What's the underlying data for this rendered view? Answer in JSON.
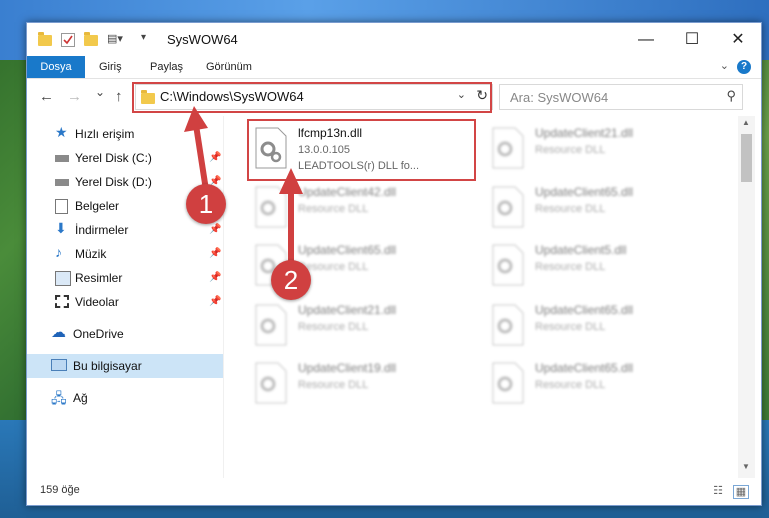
{
  "window": {
    "title": "SysWOW64",
    "controls": {
      "minimize": "—",
      "maximize": "☐",
      "close": "✕"
    }
  },
  "ribbon": {
    "tabs": [
      "Dosya",
      "Giriş",
      "Paylaş",
      "Görünüm"
    ],
    "expand_icon": "chevron-down-icon",
    "help_label": "?"
  },
  "nav": {
    "back": "←",
    "forward": "→",
    "recent": "⌄",
    "up": "↑",
    "address": "C:\\Windows\\SysWOW64",
    "search_placeholder": "Ara: SysWOW64"
  },
  "sidebar": {
    "items": [
      {
        "label": "Hızlı erişim",
        "icon": "star-icon",
        "pinned": false
      },
      {
        "label": "Yerel Disk (C:)",
        "icon": "drive-icon",
        "pinned": true
      },
      {
        "label": "Yerel Disk (D:)",
        "icon": "drive-icon",
        "pinned": true
      },
      {
        "label": "Belgeler",
        "icon": "document-icon",
        "pinned": true
      },
      {
        "label": "İndirmeler",
        "icon": "download-icon",
        "pinned": true
      },
      {
        "label": "Müzik",
        "icon": "music-icon",
        "pinned": true
      },
      {
        "label": "Resimler",
        "icon": "pictures-icon",
        "pinned": true
      },
      {
        "label": "Videolar",
        "icon": "video-icon",
        "pinned": true
      },
      {
        "label": "OneDrive",
        "icon": "cloud-icon",
        "pinned": false
      },
      {
        "label": "Bu bilgisayar",
        "icon": "computer-icon",
        "pinned": false,
        "selected": true
      },
      {
        "label": "Ağ",
        "icon": "network-icon",
        "pinned": false
      }
    ]
  },
  "files": [
    {
      "name": "lfcmp13n.dll",
      "line2": "13.0.0.105",
      "line3": "LEADTOOLS(r) DLL fo...",
      "highlighted": true
    },
    {
      "name": "UpdateClient21.dll",
      "line2": "Resource DLL"
    },
    {
      "name": "UpdateClient42.dll",
      "line2": "Resource DLL"
    },
    {
      "name": "UpdateClient65.dll",
      "line2": "Resource DLL"
    },
    {
      "name": "UpdateClient65.dll",
      "line2": "Resource DLL"
    },
    {
      "name": "UpdateClient5.dll",
      "line2": "Resource DLL"
    },
    {
      "name": "UpdateClient21.dll",
      "line2": "Resource DLL"
    },
    {
      "name": "UpdateClient65.dll",
      "line2": "Resource DLL"
    },
    {
      "name": "UpdateClient19.dll",
      "line2": "Resource DLL"
    },
    {
      "name": "UpdateClient65.dll",
      "line2": "Resource DLL"
    }
  ],
  "status": {
    "count": "159 öğe"
  },
  "annotations": [
    {
      "label": "1",
      "color": "#d04040"
    },
    {
      "label": "2",
      "color": "#d04040"
    }
  ]
}
